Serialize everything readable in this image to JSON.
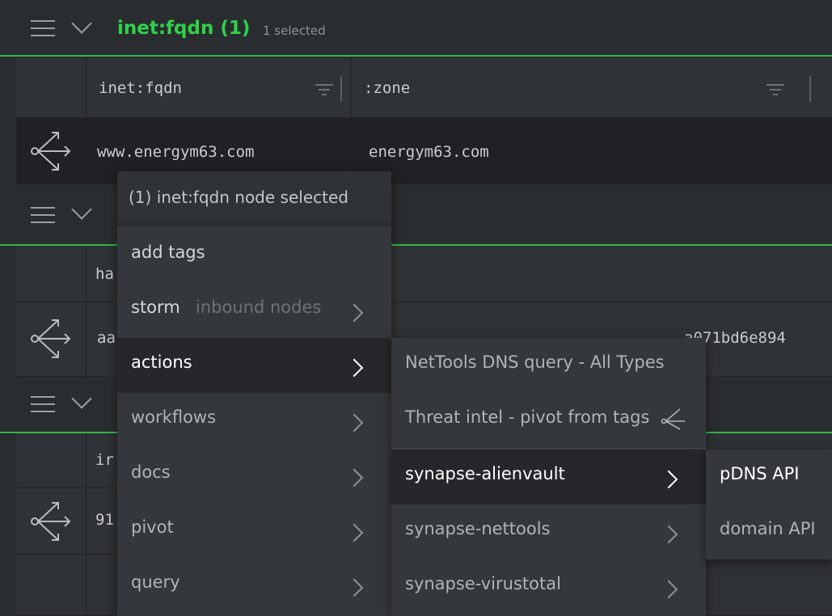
{
  "panes": [
    {
      "title": "inet:fqdn (1)",
      "subtitle": "1 selected",
      "columns": [
        "inet:fqdn",
        ":zone"
      ],
      "row": [
        "www.energym63.com",
        "energym63.com"
      ]
    },
    {
      "column_partial": "ha",
      "row_partial": "aa",
      "row_hash_partial": "a071bd6e894"
    },
    {
      "column_partial": "ir",
      "row_partial": "91"
    }
  ],
  "context_menu": {
    "header": "(1) inet:fqdn node selected",
    "items": [
      {
        "label": "add tags"
      },
      {
        "label": "storm",
        "hint": "inbound nodes"
      },
      {
        "label": "actions"
      },
      {
        "label": "workflows"
      },
      {
        "label": "docs"
      },
      {
        "label": "pivot"
      },
      {
        "label": "query"
      }
    ]
  },
  "actions_menu": {
    "items": [
      {
        "label": "NetTools DNS query - All Types"
      },
      {
        "label": "Threat intel - pivot from tags"
      },
      {
        "label": "synapse-alienvault"
      },
      {
        "label": "synapse-nettools"
      },
      {
        "label": "synapse-virustotal"
      }
    ]
  },
  "alienvault_menu": {
    "items": [
      {
        "label": "pDNS API"
      },
      {
        "label": "domain API"
      }
    ]
  },
  "colors": {
    "accent": "#2fd14a",
    "background": "#2a2d30",
    "menu": "#34373b"
  }
}
